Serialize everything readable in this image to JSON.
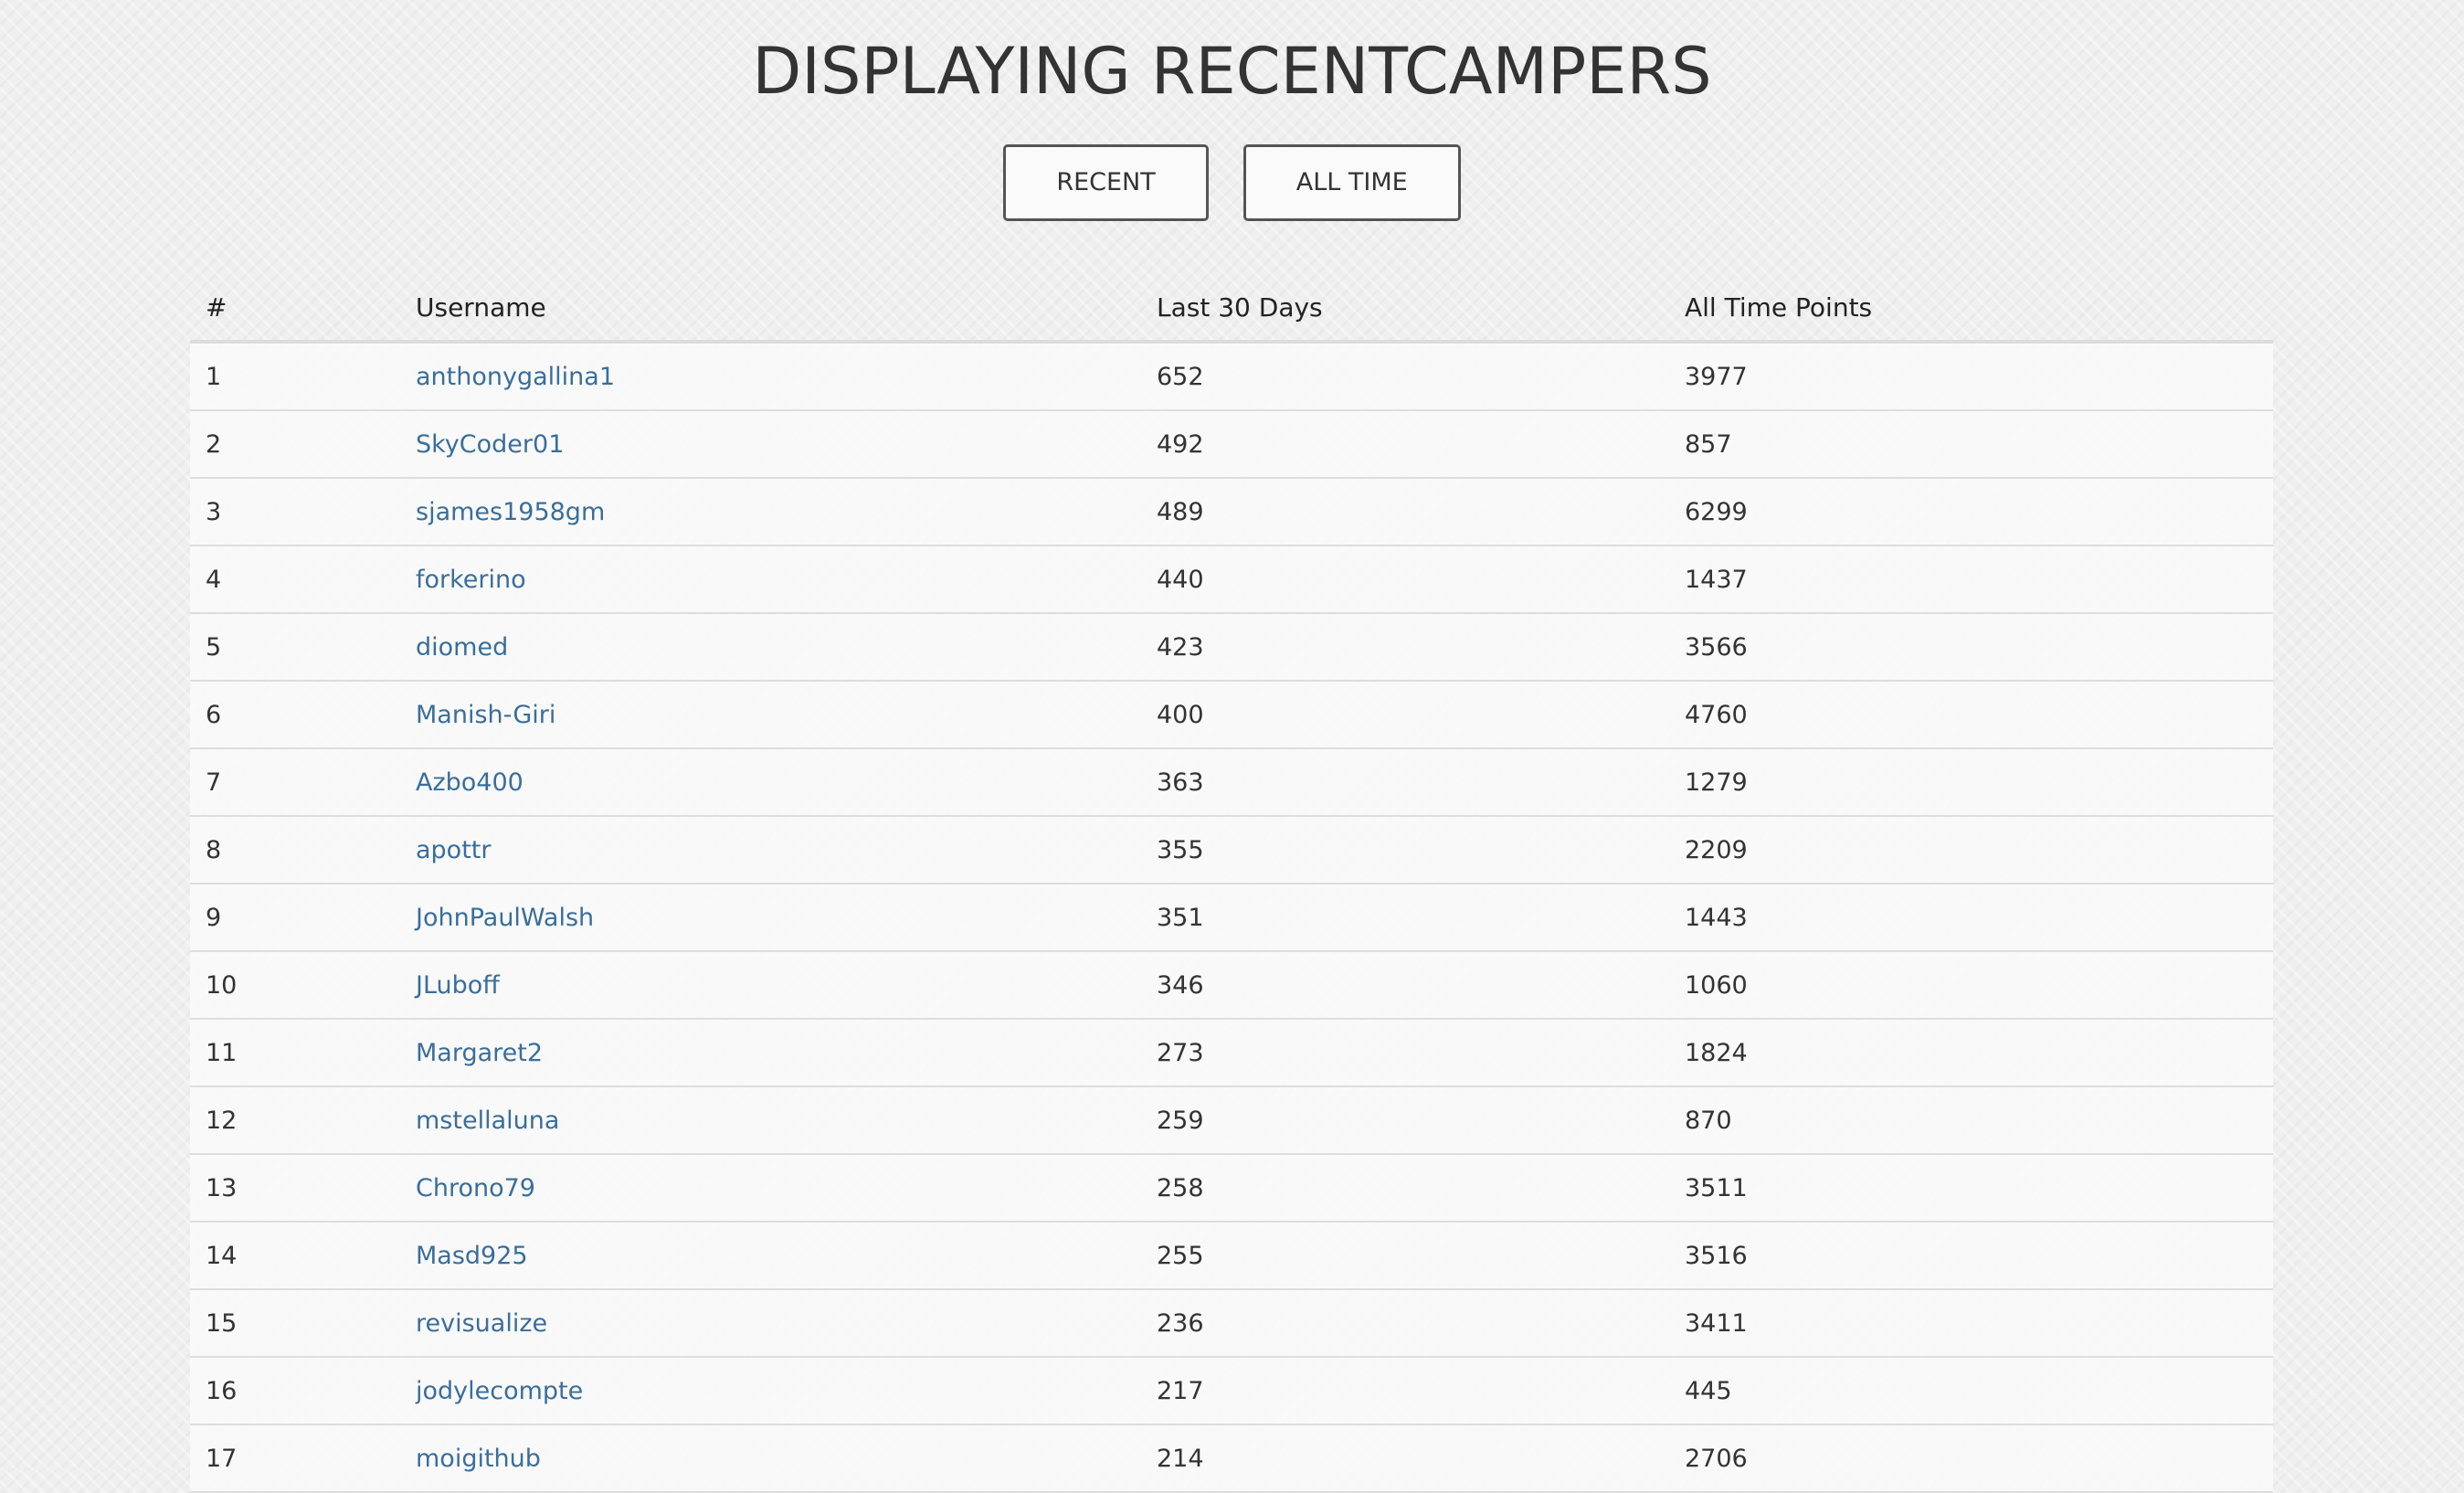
{
  "title": "DISPLAYING RECENTCAMPERS",
  "toggle": {
    "recent_label": "RECENT",
    "alltime_label": "ALL TIME"
  },
  "table": {
    "headers": {
      "rank": "#",
      "username": "Username",
      "recent": "Last 30 Days",
      "alltime": "All Time Points"
    },
    "rows": [
      {
        "rank": "1",
        "username": "anthonygallina1",
        "recent": "652",
        "alltime": "3977"
      },
      {
        "rank": "2",
        "username": "SkyCoder01",
        "recent": "492",
        "alltime": "857"
      },
      {
        "rank": "3",
        "username": "sjames1958gm",
        "recent": "489",
        "alltime": "6299"
      },
      {
        "rank": "4",
        "username": "forkerino",
        "recent": "440",
        "alltime": "1437"
      },
      {
        "rank": "5",
        "username": "diomed",
        "recent": "423",
        "alltime": "3566"
      },
      {
        "rank": "6",
        "username": "Manish-Giri",
        "recent": "400",
        "alltime": "4760"
      },
      {
        "rank": "7",
        "username": "Azbo400",
        "recent": "363",
        "alltime": "1279"
      },
      {
        "rank": "8",
        "username": "apottr",
        "recent": "355",
        "alltime": "2209"
      },
      {
        "rank": "9",
        "username": "JohnPaulWalsh",
        "recent": "351",
        "alltime": "1443"
      },
      {
        "rank": "10",
        "username": "JLuboff",
        "recent": "346",
        "alltime": "1060"
      },
      {
        "rank": "11",
        "username": "Margaret2",
        "recent": "273",
        "alltime": "1824"
      },
      {
        "rank": "12",
        "username": "mstellaluna",
        "recent": "259",
        "alltime": "870"
      },
      {
        "rank": "13",
        "username": "Chrono79",
        "recent": "258",
        "alltime": "3511"
      },
      {
        "rank": "14",
        "username": "Masd925",
        "recent": "255",
        "alltime": "3516"
      },
      {
        "rank": "15",
        "username": "revisualize",
        "recent": "236",
        "alltime": "3411"
      },
      {
        "rank": "16",
        "username": "jodylecompte",
        "recent": "217",
        "alltime": "445"
      },
      {
        "rank": "17",
        "username": "moigithub",
        "recent": "214",
        "alltime": "2706"
      }
    ]
  },
  "colors": {
    "link": "#3a6e9a",
    "text": "#333333",
    "background": "#efefef"
  }
}
